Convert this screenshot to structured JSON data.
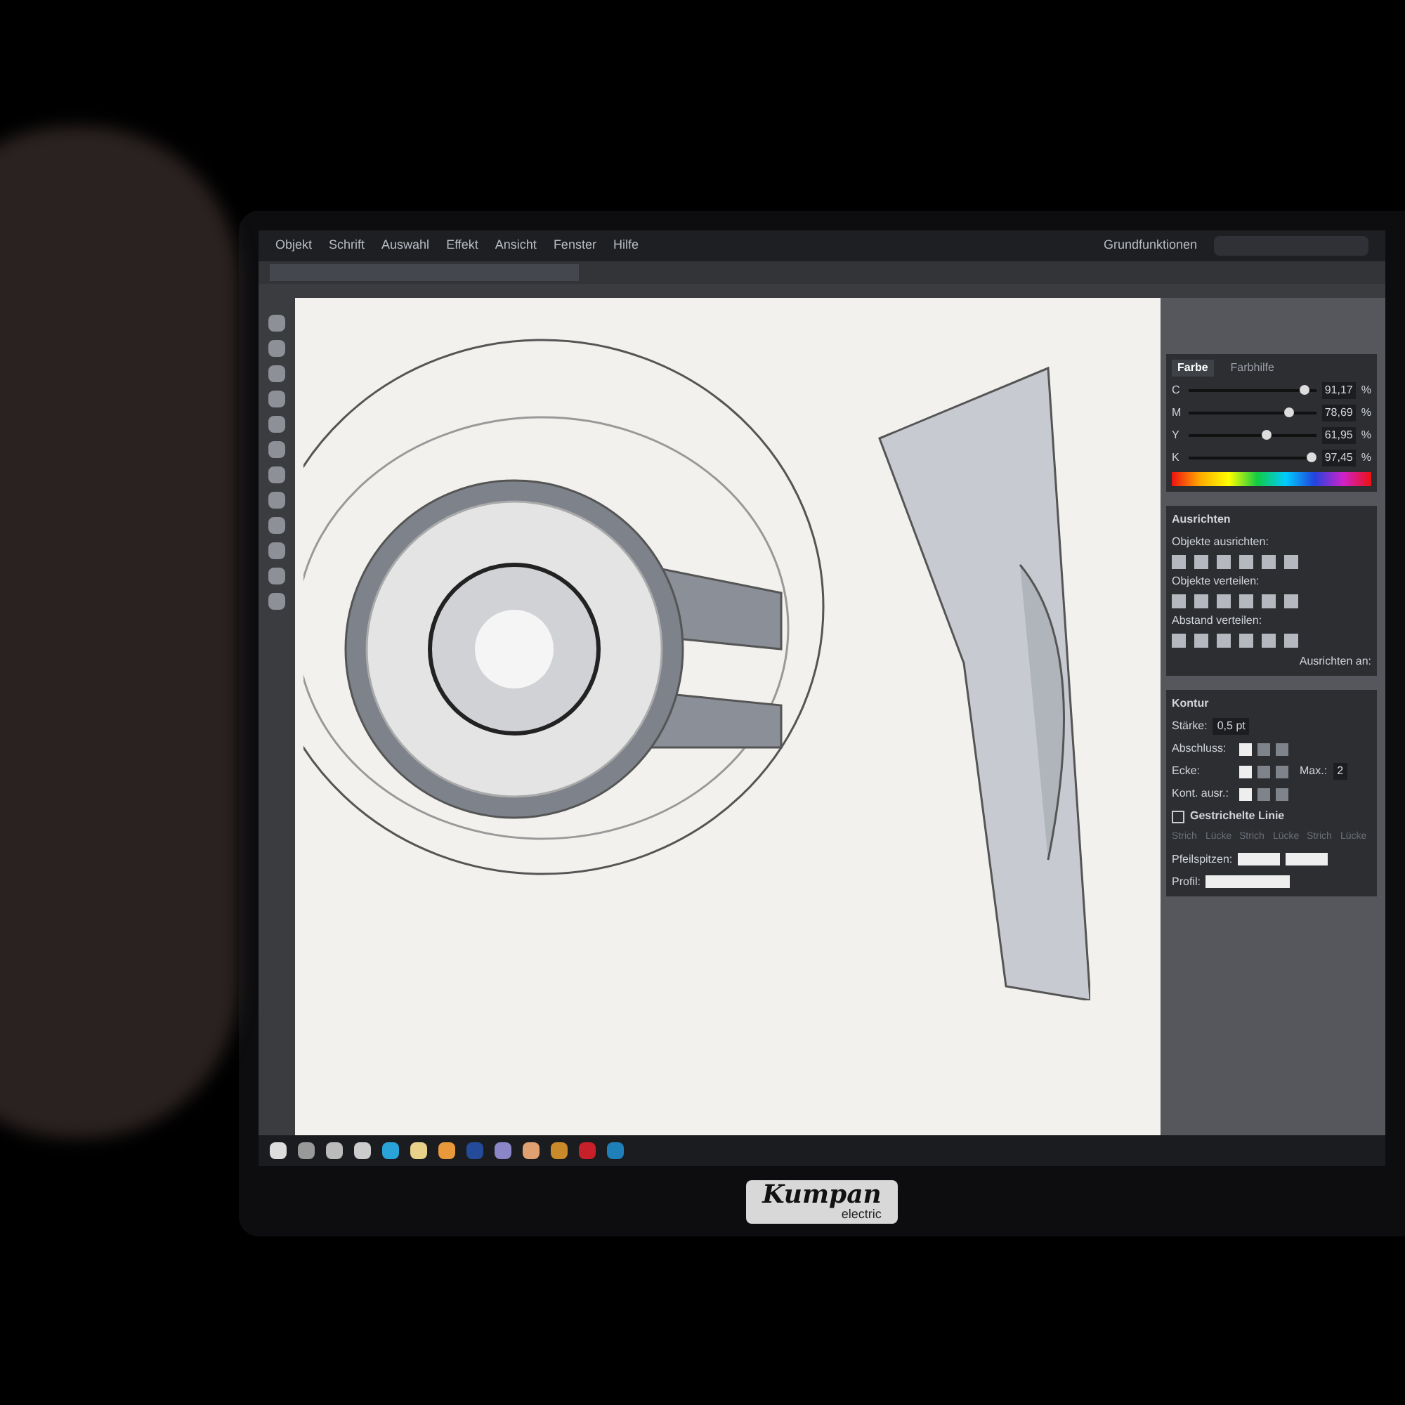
{
  "menu_bar": {
    "items": [
      "Objekt",
      "Schrift",
      "Auswahl",
      "Effekt",
      "Ansicht",
      "Fenster",
      "Hilfe"
    ],
    "workspace": "Grundfunktionen"
  },
  "color_panel": {
    "tabs": [
      {
        "label": "Farbe",
        "selected": true
      },
      {
        "label": "Farbhilfe",
        "selected": false
      }
    ],
    "channels": [
      {
        "name": "C",
        "level": 0.91,
        "value": "91,17",
        "unit": "%"
      },
      {
        "name": "M",
        "level": 0.79,
        "value": "78,69",
        "unit": "%"
      },
      {
        "name": "Y",
        "level": 0.62,
        "value": "61,95",
        "unit": "%"
      },
      {
        "name": "K",
        "level": 0.97,
        "value": "97,45",
        "unit": "%"
      }
    ]
  },
  "align_panel": {
    "title": "Ausrichten",
    "sections": [
      "Objekte ausrichten:",
      "Objekte verteilen:",
      "Abstand verteilen:"
    ],
    "align_to_label": "Ausrichten an:"
  },
  "stroke_panel": {
    "title": "Kontur",
    "weight_label": "Stärke:",
    "weight": "0,5 pt",
    "cap_label": "Abschluss:",
    "corner_label": "Ecke:",
    "align_label": "Kont. ausr.:",
    "limit_label": "Max.:",
    "limit": "2",
    "dashed": {
      "label": "Gestrichelte Linie",
      "checked": false
    },
    "dash_fields": [
      "Strich",
      "Lücke",
      "Strich",
      "Lücke",
      "Strich",
      "Lücke"
    ],
    "arrowheads_label": "Pfeilspitzen:",
    "profile_label": "Profil:"
  },
  "monitor": {
    "brand": "Kumpan",
    "brand_sub": "electric"
  }
}
